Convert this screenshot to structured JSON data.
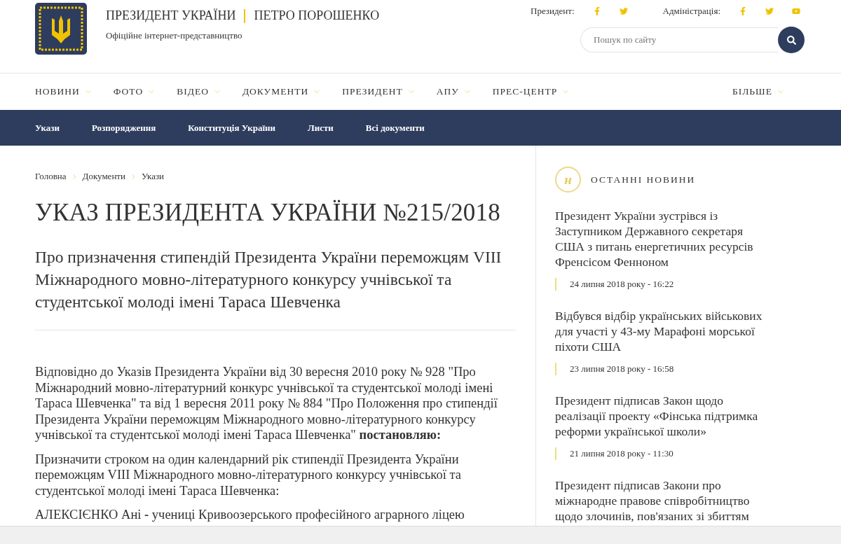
{
  "header": {
    "title_left": "ПРЕЗИДЕНТ УКРАЇНИ",
    "title_right": "ПЕТРО ПОРОШЕНКО",
    "subtitle": "Офіційне інтернет-представництво",
    "social": [
      {
        "label": "Президент:",
        "icons": [
          {
            "kind": "facebook"
          },
          {
            "kind": "twitter"
          }
        ]
      },
      {
        "label": "Адміністрація:",
        "icons": [
          {
            "kind": "facebook"
          },
          {
            "kind": "twitter"
          },
          {
            "kind": "youtube"
          }
        ]
      }
    ],
    "search": {
      "placeholder": "Пошук по сайту"
    }
  },
  "nav": {
    "items": [
      "НОВИНИ",
      "ФОТО",
      "ВІДЕО",
      "ДОКУМЕНТИ",
      "ПРЕЗИДЕНТ",
      "АПУ",
      "ПРЕС-ЦЕНТР"
    ],
    "more": "БІЛЬШЕ"
  },
  "subnav": [
    "Укази",
    "Розпорядження",
    "Конституція України",
    "Листи",
    "Всі документи"
  ],
  "breadcrumbs": [
    "Головна",
    "Документи",
    "Укази"
  ],
  "title": "УКАЗ ПРЕЗИДЕНТА УКРАЇНИ №215/2018",
  "subtitle": "Про призначення стипендій Президента України переможцям VIII Міжнародного мовно-літературного конкурсу учнівської та студентської молоді імені Тараса Шевченка",
  "paragraphs": [
    "Відповідно до Указів Президента України від 30 вересня 2010 року № 928 \"Про Міжнародний мовно-літературний конкурс учнівської та студентської молоді імені Тараса Шевченка\" та від 1 вересня 2011 року № 884 \"Про Положення про стипендії Президента України переможцям Міжнародного мовно-літературного конкурсу учнівської та студентської молоді імені Тараса Шевченка\" **постановляю:**",
    "Призначити строком на один календарний рік стипендії Президента України переможцям VIII Міжнародного мовно-літературного конкурсу учнівської та студентської молоді імені Тараса Шевченка:",
    "АЛЕКСІЄНКО Ані **-** учениці Кривоозерського професійного аграрного ліцею"
  ],
  "sidebar": {
    "badge": "н",
    "heading": "ОСТАННІ НОВИНИ",
    "news": [
      {
        "title": "Президент України зустрівся із Заступником Державного секретаря США з питань енергетичних ресурсів Френсісом Фенноном",
        "date": "24 липня 2018 року - 16:22"
      },
      {
        "title": "Відбувся відбір українських військових для участі у 43-му Марафоні морської піхоти США",
        "date": "23 липня 2018 року - 16:58"
      },
      {
        "title": "Президент підписав Закон щодо реалізації проекту «Фінська підтримка реформи української школи»",
        "date": "21 липня 2018 року - 11:30"
      },
      {
        "title": "Президент підписав Закони про міжнародне правове співробітництво щодо злочинів, пов'язаних зі збиттям"
      }
    ]
  }
}
